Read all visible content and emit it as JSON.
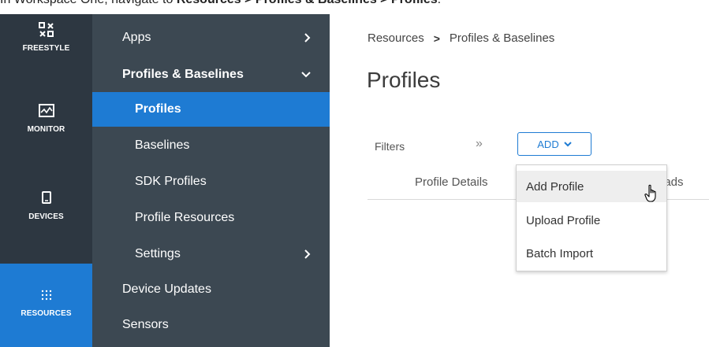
{
  "instruction": {
    "prefix": "In Workspace One, navigate to ",
    "path_1": "Resources",
    "sep_1": " > ",
    "path_2": "Profiles & Baselines",
    "sep_2": " > ",
    "path_3": "Profiles",
    "suffix": "."
  },
  "rail": {
    "items": [
      {
        "label": "FREESTYLE",
        "icon": "freestyle-icon"
      },
      {
        "label": "MONITOR",
        "icon": "monitor-icon"
      },
      {
        "label": "DEVICES",
        "icon": "device-icon"
      },
      {
        "label": "RESOURCES",
        "icon": "resources-grid-icon",
        "active": true
      }
    ]
  },
  "nav": {
    "items": [
      {
        "label": "Apps",
        "chevron": "right"
      },
      {
        "label": "Profiles & Baselines",
        "chevron": "down",
        "expanded": true
      },
      {
        "label": "Profiles",
        "selected": true
      },
      {
        "label": "Baselines"
      },
      {
        "label": "SDK Profiles"
      },
      {
        "label": "Profile Resources"
      },
      {
        "label": "Settings",
        "chevron": "right"
      },
      {
        "label": "Device Updates"
      },
      {
        "label": "Sensors"
      }
    ]
  },
  "main": {
    "breadcrumb": {
      "part1": "Resources",
      "separator": ">",
      "part2": "Profiles & Baselines"
    },
    "title": "Profiles",
    "filters_label": "Filters",
    "filters_toggle": "»",
    "add_button": "ADD",
    "columns": {
      "details": "Profile Details",
      "loads": "oads"
    },
    "menu": {
      "items": [
        {
          "label": "Add Profile",
          "hover": true
        },
        {
          "label": "Upload Profile"
        },
        {
          "label": "Batch Import"
        }
      ]
    }
  },
  "colors": {
    "rail_bg": "#2d3741",
    "nav_bg": "#3c4852",
    "accent": "#1e7bd3"
  }
}
